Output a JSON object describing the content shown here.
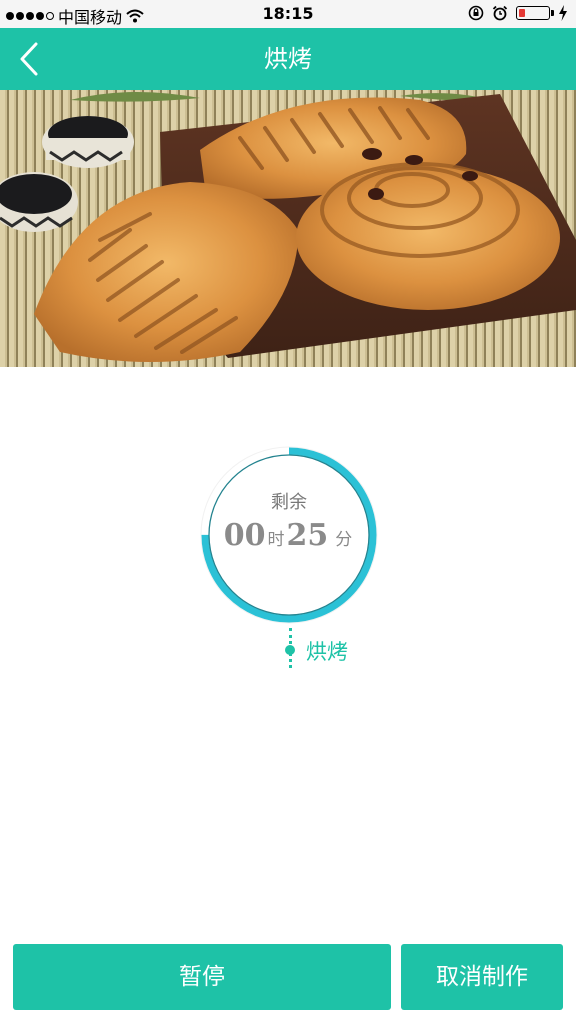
{
  "status_bar": {
    "carrier": "中国移动",
    "time": "18:15",
    "signal_icon": "signal-dots-icon",
    "wifi_icon": "wifi-icon",
    "battery_color": "#e53935"
  },
  "nav": {
    "title": "烘烤",
    "back_icon": "chevron-left-icon",
    "color": "#1ec2a7"
  },
  "hero": {
    "image": "pastries-photo"
  },
  "timer": {
    "label": "剩余",
    "hours": "00",
    "hour_unit": "时",
    "minutes": "25",
    "minute_unit": "分",
    "progress": 0.75,
    "ring_color": "#2bc1d6"
  },
  "stage": {
    "label": "烘烤"
  },
  "actions": {
    "pause_label": "暂停",
    "cancel_label": "取消制作"
  }
}
